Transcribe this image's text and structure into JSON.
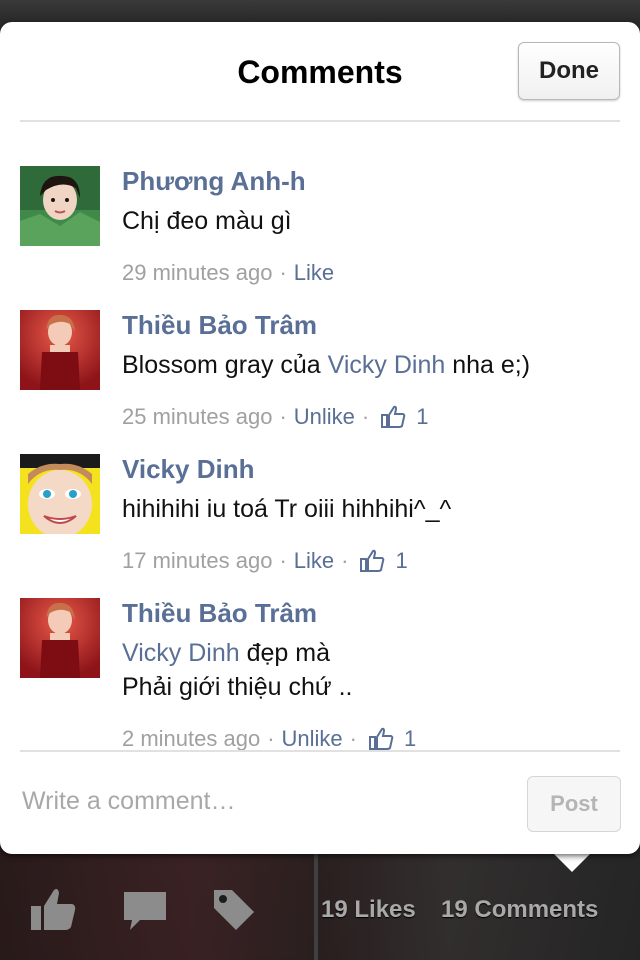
{
  "dialog": {
    "title": "Comments",
    "done_label": "Done"
  },
  "comments": [
    {
      "author": "Phương Anh-h",
      "body_parts": [
        {
          "text": "Chị đeo màu gì",
          "mention": false
        }
      ],
      "time": "29 minutes ago",
      "action": "Like",
      "likes": null
    },
    {
      "author": "Thiều Bảo Trâm",
      "body_parts": [
        {
          "text": "Blossom gray của ",
          "mention": false
        },
        {
          "text": "Vicky Dinh",
          "mention": true
        },
        {
          "text": " nha e;)",
          "mention": false
        }
      ],
      "time": "25 minutes ago",
      "action": "Unlike",
      "likes": "1"
    },
    {
      "author": "Vicky Dinh",
      "body_parts": [
        {
          "text": "hihihihi iu toá Tr oiii hihhihi^_^",
          "mention": false
        }
      ],
      "time": "17 minutes ago",
      "action": "Like",
      "likes": "1"
    },
    {
      "author": "Thiều Bảo Trâm",
      "body_line1_parts": [
        {
          "text": "Vicky Dinh",
          "mention": true
        },
        {
          "text": " đẹp mà",
          "mention": false
        }
      ],
      "body_line2": "Phải giới thiệu chứ ..",
      "time": "2 minutes ago",
      "action": "Unlike",
      "likes": "1"
    }
  ],
  "composer": {
    "placeholder": "Write a comment…",
    "post_label": "Post"
  },
  "bottom_bar": {
    "likes_text": "19 Likes",
    "comments_text": "19 Comments",
    "icons": [
      "like-thumb-icon",
      "comment-bubble-icon",
      "tag-icon"
    ]
  },
  "colors": {
    "link_blue": "#5a6f96",
    "meta_gray": "#a0a0a0",
    "sheet_bg": "#ffffff"
  }
}
